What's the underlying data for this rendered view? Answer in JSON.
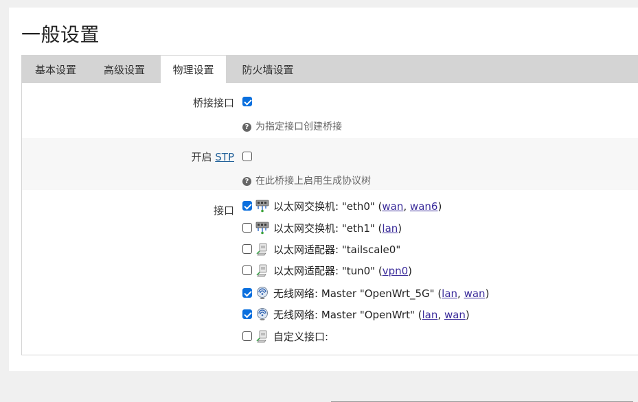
{
  "page": {
    "title": "一般设置"
  },
  "tabs": [
    {
      "label": "基本设置",
      "active": false
    },
    {
      "label": "高级设置",
      "active": false
    },
    {
      "label": "物理设置",
      "active": true
    },
    {
      "label": "防火墙设置",
      "active": false
    }
  ],
  "bridge": {
    "label": "桥接接口",
    "checked": true,
    "hint": "为指定接口创建桥接"
  },
  "stp": {
    "label_prefix": "开启",
    "label_link": "STP",
    "checked": false,
    "hint": "在此桥接上启用生成协议树"
  },
  "interfaces": {
    "label": "接口",
    "items": [
      {
        "checked": true,
        "icon": "ethernet-switch-icon",
        "text": "以太网交换机: \"eth0\" (",
        "links": [
          "wan",
          "wan6"
        ],
        "suffix": ")"
      },
      {
        "checked": false,
        "icon": "ethernet-switch-icon",
        "text": "以太网交换机: \"eth1\" (",
        "links": [
          "lan"
        ],
        "suffix": ")"
      },
      {
        "checked": false,
        "icon": "ethernet-adapter-icon",
        "text": "以太网适配器: \"tailscale0\"",
        "links": [],
        "suffix": ""
      },
      {
        "checked": false,
        "icon": "ethernet-adapter-icon",
        "text": "以太网适配器: \"tun0\" (",
        "links": [
          "vpn0"
        ],
        "suffix": ")"
      },
      {
        "checked": true,
        "icon": "wireless-icon",
        "text": "无线网络: Master \"OpenWrt_5G\" (",
        "links": [
          "lan",
          "wan"
        ],
        "suffix": ")"
      },
      {
        "checked": true,
        "icon": "wireless-icon",
        "text": "无线网络: Master \"OpenWrt\" (",
        "links": [
          "lan",
          "wan"
        ],
        "suffix": ")"
      },
      {
        "checked": false,
        "icon": "ethernet-adapter-icon",
        "text": "自定义接口:",
        "links": [],
        "suffix": ""
      }
    ],
    "custom_value": ""
  },
  "colors": {
    "accent": "#0a6fde",
    "tabbar": "#d4d4d4",
    "link": "#3a2b9a"
  }
}
